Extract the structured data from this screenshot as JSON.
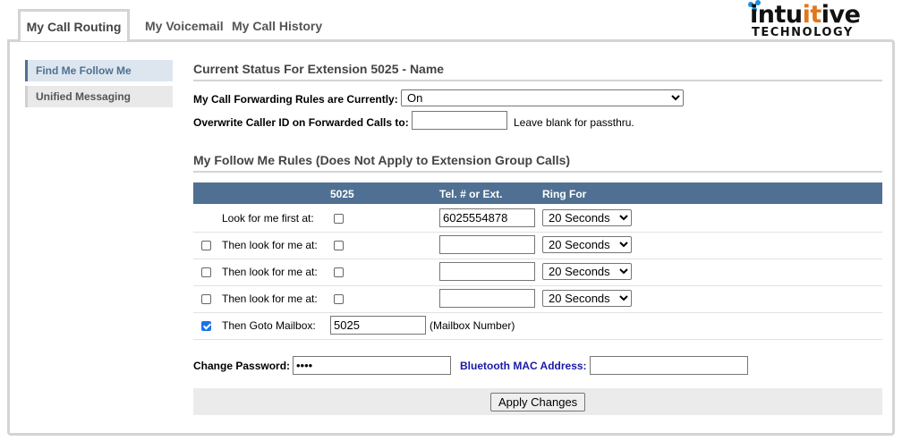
{
  "tabs": [
    {
      "label": "My Call Routing",
      "active": true
    },
    {
      "label": "My Voicemail",
      "active": false
    },
    {
      "label": "My Call History",
      "active": false
    }
  ],
  "logo": {
    "word_pre": "intu",
    "word_accent": "it",
    "word_post": "ive",
    "subword": "TECHNOLOGY"
  },
  "sidenav": [
    {
      "label": "Find Me Follow Me",
      "active": true
    },
    {
      "label": "Unified Messaging",
      "active": false
    }
  ],
  "status": {
    "title": "Current Status For Extension 5025 - Name",
    "forwarding_label": "My Call Forwarding Rules are Currently:",
    "forwarding_value": "On",
    "callerid_label": "Overwrite Caller ID on Forwarded Calls to:",
    "callerid_value": "",
    "callerid_note": "Leave blank for passthru."
  },
  "rules": {
    "title": "My Follow Me Rules (Does Not Apply to Extension Group Calls)",
    "columns": {
      "ext": "5025",
      "tel": "Tel. # or Ext.",
      "ring": "Ring For"
    },
    "rows": [
      {
        "label": "Look for me first at:",
        "has_enable": false,
        "enabled": false,
        "ext_checked": false,
        "tel": "6025554878",
        "ring": "20 Seconds"
      },
      {
        "label": "Then look for me at:",
        "has_enable": true,
        "enabled": false,
        "ext_checked": false,
        "tel": "",
        "ring": "20 Seconds"
      },
      {
        "label": "Then look for me at:",
        "has_enable": true,
        "enabled": false,
        "ext_checked": false,
        "tel": "",
        "ring": "20 Seconds"
      },
      {
        "label": "Then look for me at:",
        "has_enable": true,
        "enabled": false,
        "ext_checked": false,
        "tel": "",
        "ring": "20 Seconds"
      }
    ],
    "mailbox": {
      "label": "Then Goto Mailbox:",
      "enabled": true,
      "value": "5025",
      "note": "(Mailbox Number)"
    }
  },
  "account": {
    "password_label": "Change Password:",
    "password_value": "••••",
    "bt_label": "Bluetooth MAC Address:",
    "bt_value": "",
    "bt_label_color": "#1a1aa6"
  },
  "apply_label": "Apply Changes"
}
